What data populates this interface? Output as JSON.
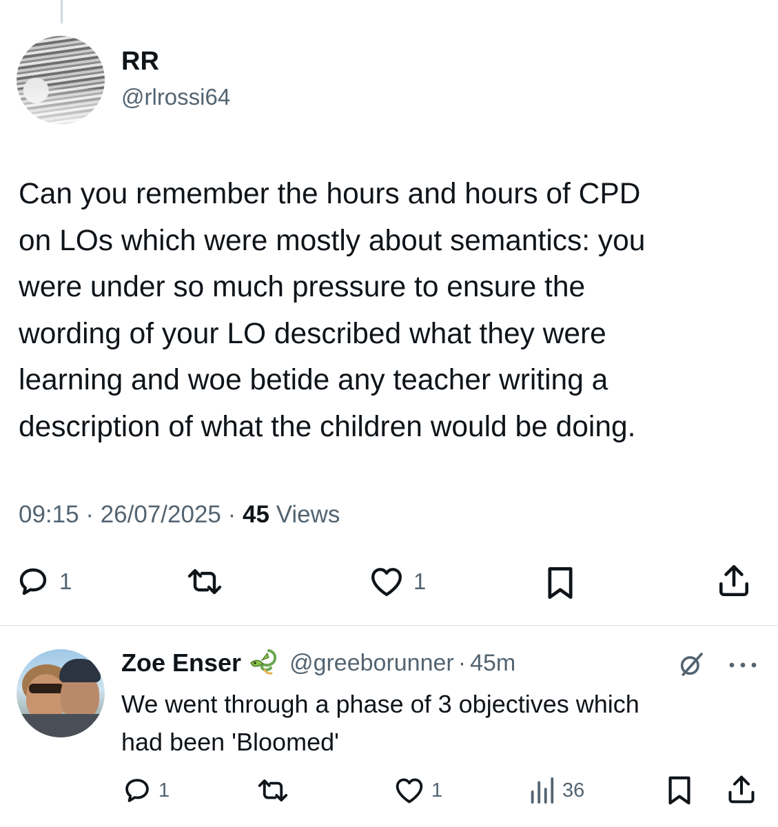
{
  "main_tweet": {
    "author_name": "RR",
    "author_handle": "@rlrossi64",
    "text_lines": [
      "Can you remember the hours and hours of CPD",
      "on LOs which were mostly about semantics: you",
      "were under so much pressure to ensure the",
      "wording of your LO described what they were",
      "learning and woe betide any teacher writing a",
      "description of what the children would be doing."
    ],
    "time": "09:15",
    "separator": "·",
    "date": "26/07/2025",
    "views_count": "45",
    "views_label": "Views",
    "actions": {
      "reply_icon": "reply-bubble-icon",
      "reply_count": "1",
      "retweet_icon": "retweet-icon",
      "like_icon": "heart-icon",
      "like_count": "1",
      "bookmark_icon": "bookmark-icon",
      "share_icon": "share-icon"
    }
  },
  "reply": {
    "author_name": "Zoe Enser",
    "name_emoji_icon": "dragon-emoji-icon",
    "author_handle": "@greeborunner",
    "separator": "·",
    "time_ago": "45m",
    "grok_icon": "grok-slash-icon",
    "more_icon": "more-dots-icon",
    "text_lines": [
      "We went through a phase of 3 objectives which",
      "had been 'Bloomed'"
    ],
    "actions": {
      "reply_count": "1",
      "like_count": "1",
      "views_count": "36"
    }
  },
  "colors": {
    "text_primary": "#0f1419",
    "text_secondary": "#536471",
    "divider": "#d5dde1",
    "dragon_green": "#8bc34a"
  }
}
